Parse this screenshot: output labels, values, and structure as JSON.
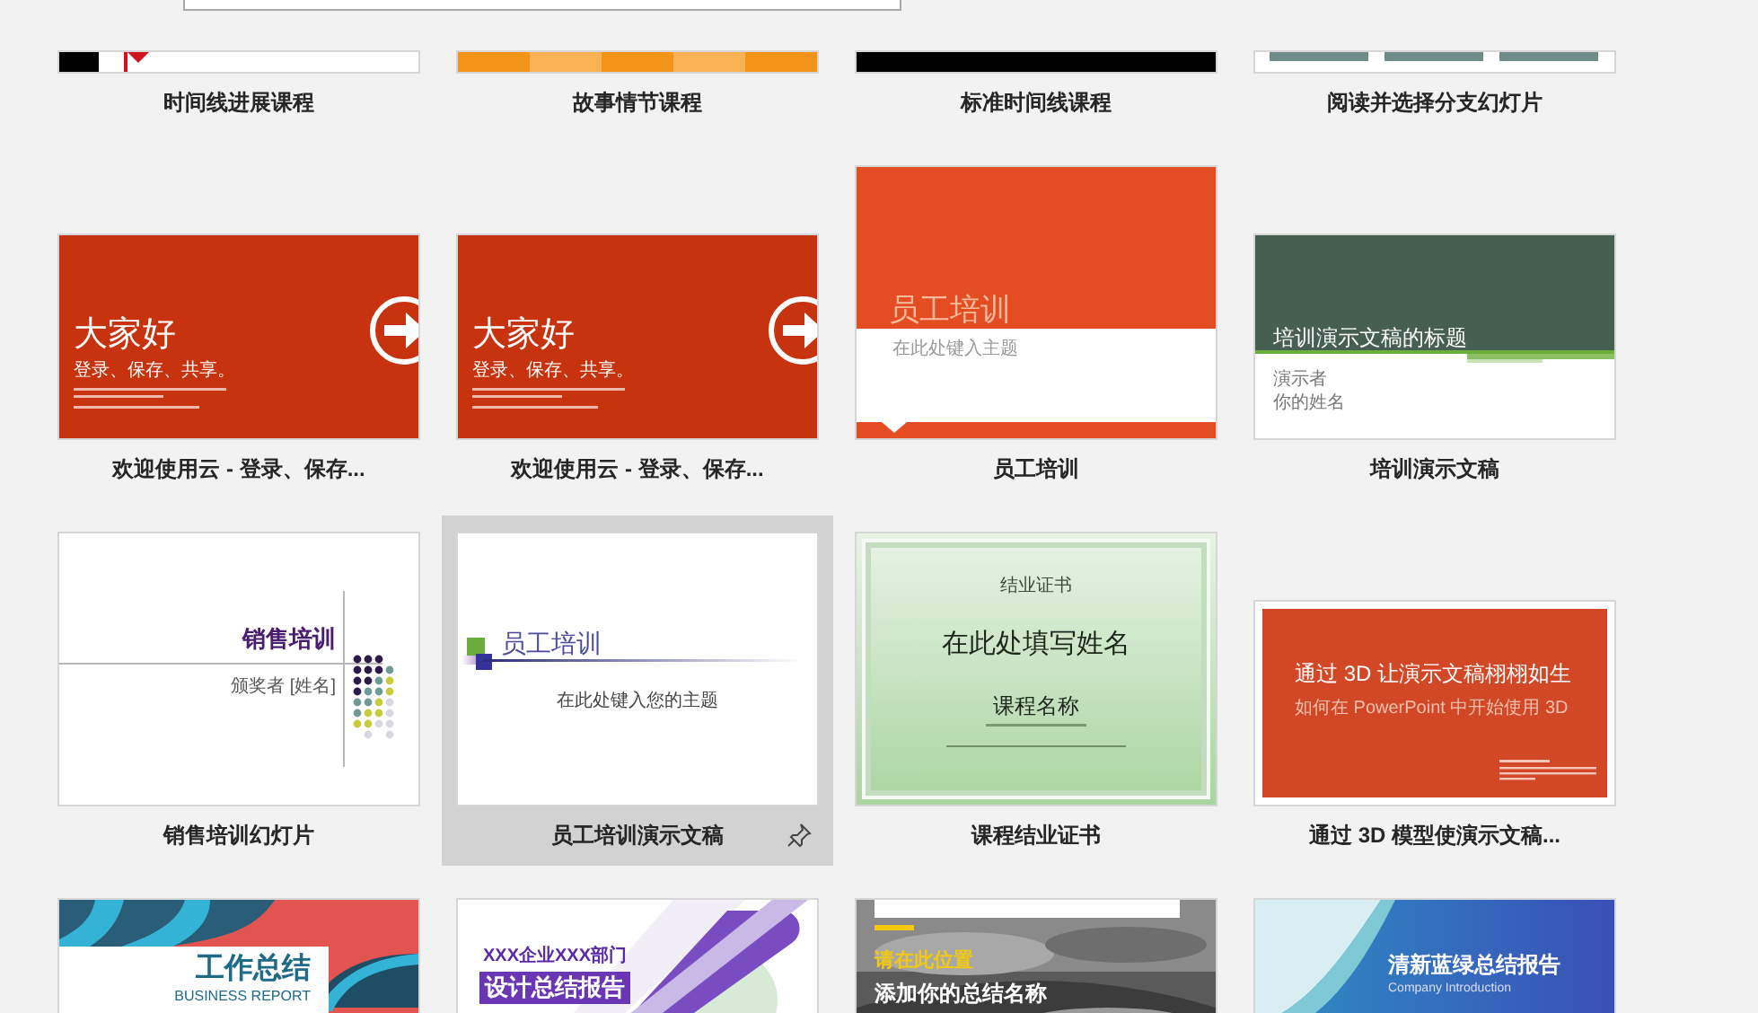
{
  "templates": [
    {
      "name": "时间线进展课程",
      "selected": false,
      "pinned": false,
      "thumbnail": {
        "kind": "timeline"
      }
    },
    {
      "name": "故事情节课程",
      "selected": false,
      "pinned": false,
      "thumbnail": {
        "kind": "story"
      }
    },
    {
      "name": "标准时间线课程",
      "selected": false,
      "pinned": false,
      "thumbnail": {
        "kind": "black"
      }
    },
    {
      "name": "阅读并选择分支幻灯片",
      "selected": false,
      "pinned": false,
      "thumbnail": {
        "kind": "teal"
      }
    },
    {
      "name": "欢迎使用云 - 登录、保存...",
      "selected": false,
      "pinned": false,
      "thumbnail": {
        "kind": "welcome",
        "texts": [
          "大家好",
          "登录、保存、共享。"
        ]
      }
    },
    {
      "name": "欢迎使用云 - 登录、保存...",
      "selected": false,
      "pinned": false,
      "thumbnail": {
        "kind": "welcome",
        "texts": [
          "大家好",
          "登录、保存、共享。"
        ]
      }
    },
    {
      "name": "员工培训",
      "selected": false,
      "pinned": false,
      "thumbnail": {
        "kind": "banner",
        "texts": [
          "员工培训",
          "在此处键入主题"
        ]
      }
    },
    {
      "name": "培训演示文稿",
      "selected": false,
      "pinned": false,
      "thumbnail": {
        "kind": "greenband",
        "texts": [
          "培训演示文稿的标题",
          "演示者",
          "你的姓名"
        ]
      }
    },
    {
      "name": "销售培训幻灯片",
      "selected": false,
      "pinned": false,
      "thumbnail": {
        "kind": "dots",
        "texts": [
          "销售培训",
          "颁奖者 [姓名]"
        ]
      }
    },
    {
      "name": "员工培训演示文稿",
      "selected": true,
      "pinned": true,
      "thumbnail": {
        "kind": "classic",
        "texts": [
          "员工培训",
          "在此处键入您的主题"
        ]
      }
    },
    {
      "name": "课程结业证书",
      "selected": false,
      "pinned": false,
      "thumbnail": {
        "kind": "certificate",
        "texts": [
          "结业证书",
          "在此处填写姓名",
          "课程名称"
        ]
      }
    },
    {
      "name": "通过 3D 模型使演示文稿...",
      "selected": false,
      "pinned": false,
      "thumbnail": {
        "kind": "red3d",
        "texts": [
          "通过 3D 让演示文稿栩栩如生",
          "如何在 PowerPoint 中开始使用 3D"
        ]
      }
    },
    {
      "selected": false,
      "thumbnail": {
        "kind": "report",
        "texts": [
          "工作总结",
          "BUSINESS REPORT"
        ]
      }
    },
    {
      "selected": false,
      "thumbnail": {
        "kind": "purple",
        "texts": [
          "XXX企业XXX部门",
          "设计总结报告"
        ]
      }
    },
    {
      "selected": false,
      "thumbnail": {
        "texts": [
          "请在此位置",
          "添加你的总结名称"
        ]
      }
    },
    {
      "selected": false,
      "thumbnail": {
        "kind": "blue",
        "texts": [
          "清新蓝绿总结报告",
          "Company Introduction"
        ]
      }
    }
  ]
}
